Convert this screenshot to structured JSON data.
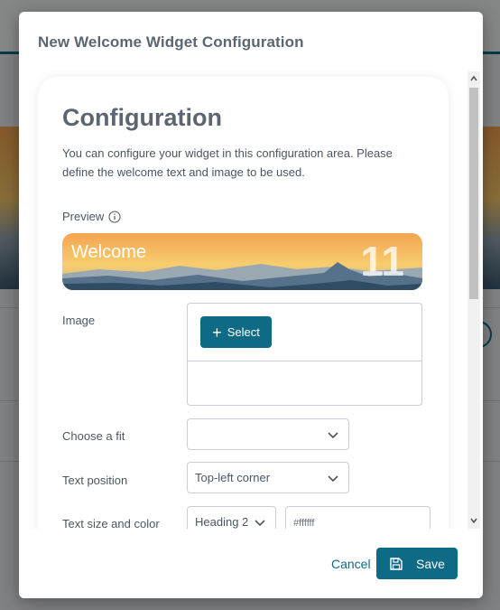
{
  "dialog": {
    "title": "New Welcome Widget Configuration"
  },
  "card": {
    "title": "Configuration",
    "description": "You can configure your widget in this configuration area. Please define the welcome text and image to be used."
  },
  "preview": {
    "label": "Preview",
    "info_icon": "info-icon",
    "banner_text": "Welcome",
    "banner_number": "11"
  },
  "image": {
    "label": "Image",
    "select_label": "Select",
    "select_icon": "plus-icon"
  },
  "fit": {
    "label": "Choose a fit",
    "value": ""
  },
  "text_position": {
    "label": "Text position",
    "value": "Top-left corner"
  },
  "text_size": {
    "label": "Text size and color",
    "size_value": "Heading 2",
    "color_value": "#ffffff"
  },
  "footer": {
    "cancel_label": "Cancel",
    "save_label": "Save",
    "save_icon": "floppy-disk-icon"
  },
  "colors": {
    "accent": "#0e6a85",
    "title_text": "#5d6670",
    "body_text": "#4c5660"
  }
}
